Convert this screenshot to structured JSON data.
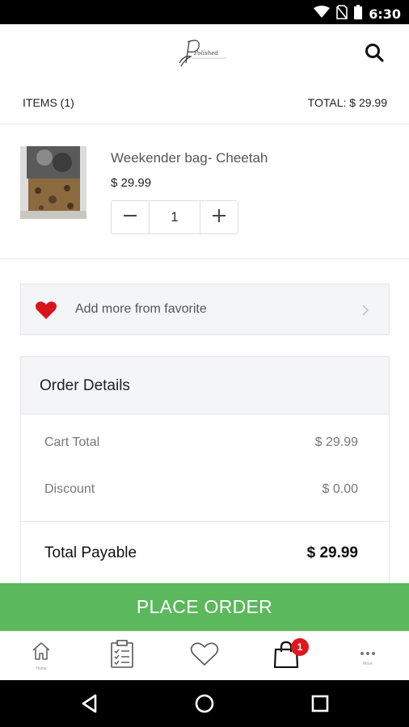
{
  "status_bar": {
    "time": "6:30"
  },
  "header": {
    "logo_text": "Polished",
    "search_icon": "search-icon"
  },
  "items_bar": {
    "items_count": "ITEMS (1)",
    "total": "TOTAL: $ 29.99"
  },
  "cart": {
    "item": {
      "name": "Weekender bag- Cheetah",
      "price": "$ 29.99",
      "quantity": "1"
    }
  },
  "favorites": {
    "label": "Add more from favorite",
    "heart_color": "#d7141c"
  },
  "order_details": {
    "title": "Order Details",
    "rows": [
      {
        "label": "Cart Total",
        "value": "$ 29.99"
      },
      {
        "label": "Discount",
        "value": "$ 0.00"
      }
    ],
    "total_label": "Total Payable",
    "total_value": "$ 29.99"
  },
  "place_order": {
    "label": "PLACE ORDER",
    "color": "#5cb85c"
  },
  "bottom_nav": {
    "home_caption": "Home",
    "more_caption": "More",
    "cart_badge": "1",
    "badge_color": "#e0161e"
  }
}
